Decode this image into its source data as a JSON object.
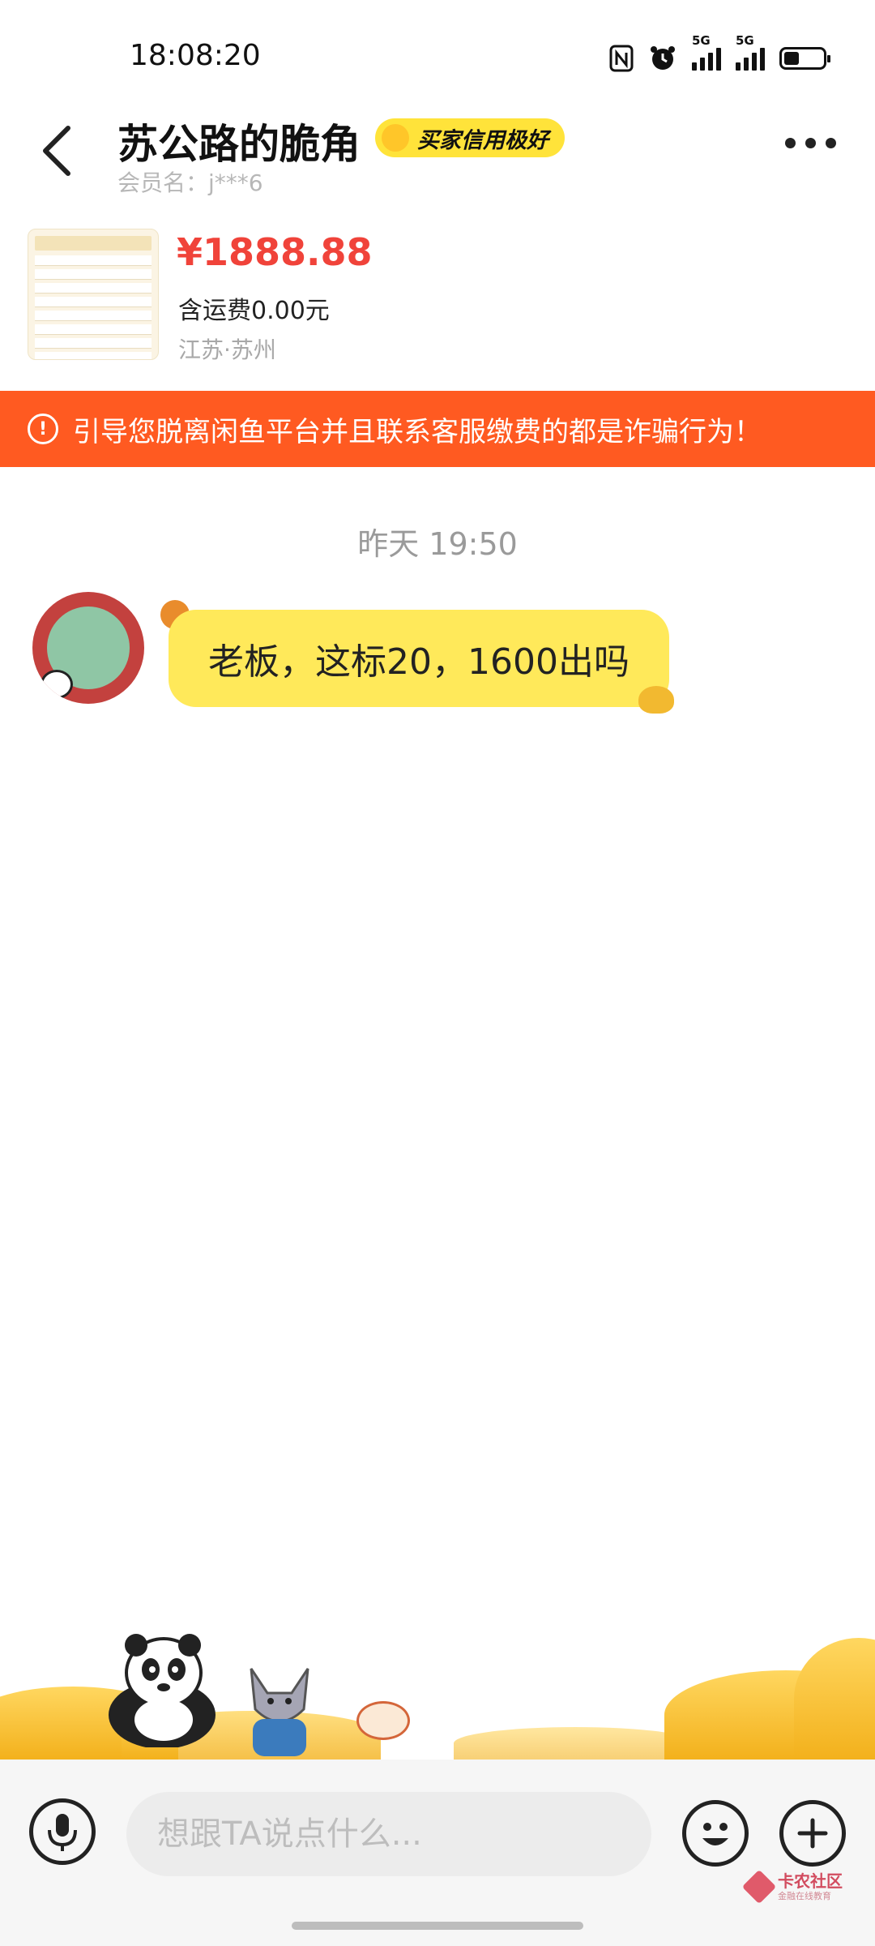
{
  "status_bar": {
    "time": "18:08:20",
    "network_1": "5G",
    "network_2": "5G",
    "battery_level": 0.3
  },
  "header": {
    "seller_name": "苏公路的脆角",
    "credit_badge": "买家信用极好",
    "member_name": "会员名：j***6"
  },
  "product": {
    "price": "¥1888.88",
    "shipping": "含运费0.00元",
    "location": "江苏·苏州"
  },
  "warning": {
    "text": "引导您脱离闲鱼平台并且联系客服缴费的都是诈骗行为！"
  },
  "chat": {
    "timestamp": "昨天 19:50",
    "messages": [
      {
        "text": "老板，这标20，1600出吗"
      }
    ]
  },
  "input": {
    "placeholder": "想跟TA说点什么..."
  },
  "watermark": {
    "title": "卡农社区",
    "subtitle": "金融在线教育"
  },
  "colors": {
    "accent_yellow": "#ffe95a",
    "warning_orange": "#ff5a21",
    "price_red": "#f0433a"
  }
}
